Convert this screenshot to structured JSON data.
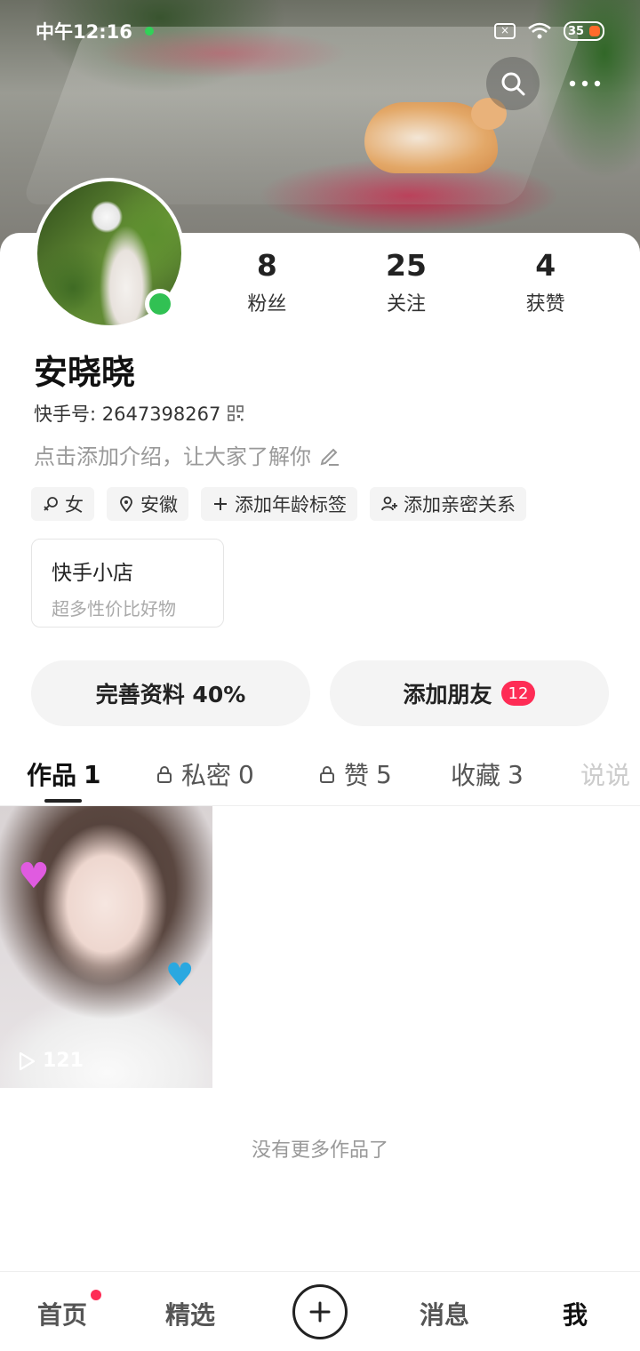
{
  "status_bar": {
    "time": "中午12:16",
    "battery": "35"
  },
  "profile": {
    "name": "安晓晓",
    "kuaishou_id": "快手号: 2647398267",
    "bio_placeholder": "点击添加介绍，让大家了解你",
    "stats": [
      {
        "num": "8",
        "label": "粉丝"
      },
      {
        "num": "25",
        "label": "关注"
      },
      {
        "num": "4",
        "label": "获赞"
      }
    ],
    "tags": [
      {
        "label": "女",
        "icon": "gender-female-icon"
      },
      {
        "label": "安徽",
        "icon": "location-pin-icon"
      },
      {
        "label": "添加年龄标签",
        "icon": "plus-icon"
      },
      {
        "label": "添加亲密关系",
        "icon": "add-person-icon"
      }
    ]
  },
  "shop": {
    "title": "快手小店",
    "subtitle": "超多性价比好物"
  },
  "actions": {
    "complete_profile": "完善资料 40%",
    "add_friends": "添加朋友",
    "add_friends_badge": "12"
  },
  "tabs": [
    {
      "label": "作品",
      "count": "1"
    },
    {
      "label": "私密",
      "count": "0"
    },
    {
      "label": "赞",
      "count": "5"
    },
    {
      "label": "收藏",
      "count": "3"
    },
    {
      "label": "说说",
      "count": ""
    }
  ],
  "works": [
    {
      "views": "121"
    }
  ],
  "empty_hint": "没有更多作品了",
  "bottom_nav": [
    {
      "label": "首页"
    },
    {
      "label": "精选"
    },
    {
      "label": "消息"
    },
    {
      "label": "我"
    }
  ],
  "colors": {
    "accent": "#fe2c55",
    "online": "#31c153"
  }
}
